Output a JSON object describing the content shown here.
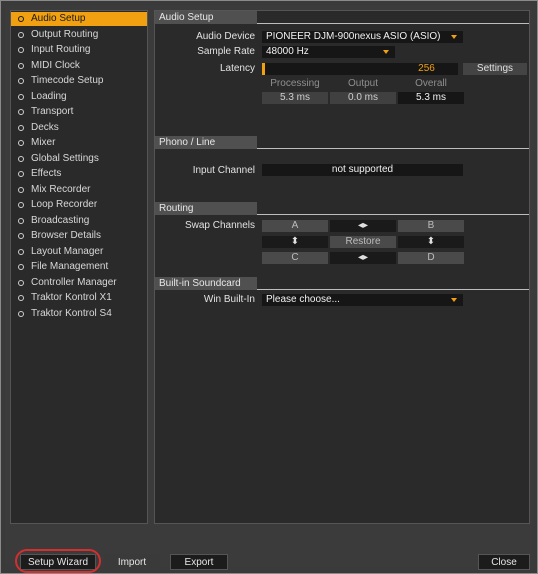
{
  "sidebar": {
    "items": [
      {
        "label": "Audio Setup",
        "active": true
      },
      {
        "label": "Output Routing"
      },
      {
        "label": "Input Routing"
      },
      {
        "label": "MIDI Clock"
      },
      {
        "label": "Timecode Setup"
      },
      {
        "label": "Loading"
      },
      {
        "label": "Transport"
      },
      {
        "label": "Decks"
      },
      {
        "label": "Mixer"
      },
      {
        "label": "Global Settings"
      },
      {
        "label": "Effects"
      },
      {
        "label": "Mix Recorder"
      },
      {
        "label": "Loop Recorder"
      },
      {
        "label": "Broadcasting"
      },
      {
        "label": "Browser Details"
      },
      {
        "label": "Layout Manager"
      },
      {
        "label": "File Management"
      },
      {
        "label": "Controller Manager"
      },
      {
        "label": "Traktor Kontrol X1"
      },
      {
        "label": "Traktor Kontrol S4"
      }
    ]
  },
  "audio_setup": {
    "header": "Audio Setup",
    "audio_device_label": "Audio Device",
    "audio_device_value": "PIONEER DJM-900nexus ASIO (ASIO)",
    "sample_rate_label": "Sample Rate",
    "sample_rate_value": "48000 Hz",
    "latency_label": "Latency",
    "latency_value": "256",
    "latency_level": 0.02,
    "settings_button": "Settings",
    "processing_label": "Processing",
    "output_label": "Output",
    "overall_label": "Overall",
    "processing_value": "5.3 ms",
    "output_value": "0.0 ms",
    "overall_value": "5.3 ms"
  },
  "phono_line": {
    "header": "Phono / Line",
    "input_channel_label": "Input Channel",
    "input_channel_value": "not supported"
  },
  "routing": {
    "header": "Routing",
    "swap_channels_label": "Swap Channels",
    "a": "A",
    "b": "B",
    "c": "C",
    "d": "D",
    "restore": "Restore"
  },
  "builtin": {
    "header": "Built-in Soundcard",
    "win_builtin_label": "Win Built-In",
    "win_builtin_value": "Please choose..."
  },
  "footer": {
    "setup_wizard": "Setup Wizard",
    "import": "Import",
    "export": "Export",
    "close": "Close"
  },
  "colors": {
    "accent": "#f0a010",
    "highlight_ring": "#d32f2f"
  }
}
